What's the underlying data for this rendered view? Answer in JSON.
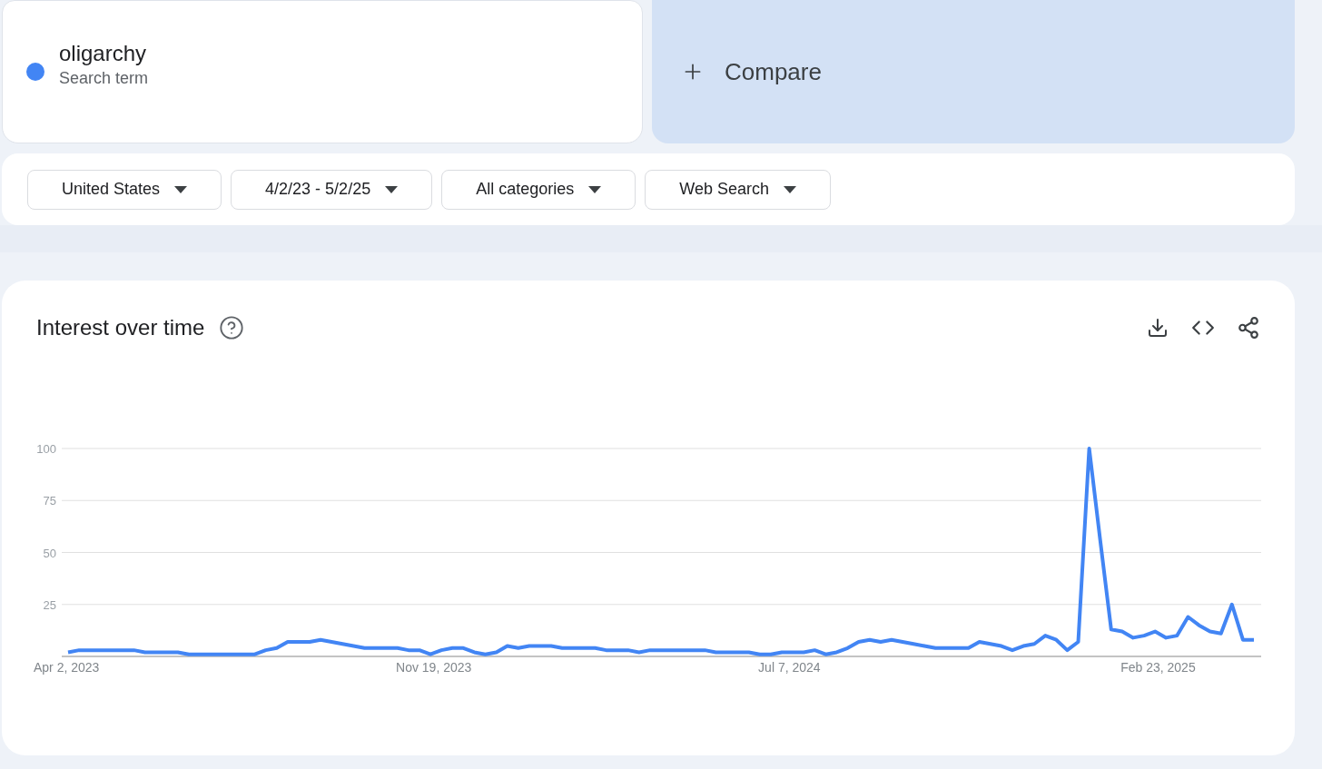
{
  "search_term": {
    "term": "oligarchy",
    "subtitle": "Search term",
    "color": "#4285f4"
  },
  "compare": {
    "label": "Compare"
  },
  "filters": [
    {
      "label": "United States"
    },
    {
      "label": "4/2/23 - 5/2/25"
    },
    {
      "label": "All categories"
    },
    {
      "label": "Web Search"
    }
  ],
  "interest_over_time": {
    "title": "Interest over time",
    "chart_data": {
      "type": "line",
      "categories": [
        "Apr 2, 2023",
        null,
        null,
        null,
        null,
        null,
        null,
        null,
        null,
        null,
        null,
        null,
        null,
        null,
        null,
        null,
        null,
        null,
        null,
        null,
        null,
        null,
        null,
        null,
        null,
        null,
        null,
        null,
        null,
        null,
        null,
        null,
        null,
        "Nov 19, 2023",
        null,
        null,
        null,
        null,
        null,
        null,
        null,
        null,
        null,
        null,
        null,
        null,
        null,
        null,
        null,
        null,
        null,
        null,
        null,
        null,
        null,
        null,
        null,
        null,
        null,
        null,
        null,
        null,
        null,
        null,
        null,
        null,
        "Jul 7, 2024",
        null,
        null,
        null,
        null,
        null,
        null,
        null,
        null,
        null,
        null,
        null,
        null,
        null,
        null,
        null,
        null,
        null,
        null,
        null,
        null,
        null,
        null,
        null,
        null,
        null,
        null,
        null,
        null,
        null,
        null,
        null,
        null,
        "Feb 23, 2025",
        null,
        null,
        null,
        null,
        null,
        null,
        null,
        null,
        null
      ],
      "series": [
        {
          "color": "#4285f4",
          "values": [
            2,
            3,
            3,
            3,
            3,
            3,
            3,
            2,
            2,
            2,
            2,
            1,
            1,
            1,
            1,
            1,
            1,
            1,
            3,
            4,
            7,
            7,
            7,
            8,
            7,
            6,
            5,
            4,
            4,
            4,
            4,
            3,
            3,
            1,
            3,
            4,
            4,
            2,
            1,
            2,
            5,
            4,
            5,
            5,
            5,
            4,
            4,
            4,
            4,
            3,
            3,
            3,
            2,
            3,
            3,
            3,
            3,
            3,
            3,
            2,
            2,
            2,
            2,
            1,
            1,
            2,
            2,
            2,
            3,
            1,
            2,
            4,
            7,
            8,
            7,
            8,
            7,
            6,
            5,
            4,
            4,
            4,
            4,
            7,
            6,
            5,
            3,
            5,
            6,
            10,
            8,
            3,
            7,
            100,
            56,
            13,
            12,
            9,
            10,
            12,
            9,
            10,
            19,
            15,
            12,
            11,
            25,
            8,
            8
          ]
        }
      ],
      "ylim": [
        0,
        100
      ],
      "grid": true,
      "yticks": [
        25,
        50,
        75,
        100
      ]
    }
  }
}
